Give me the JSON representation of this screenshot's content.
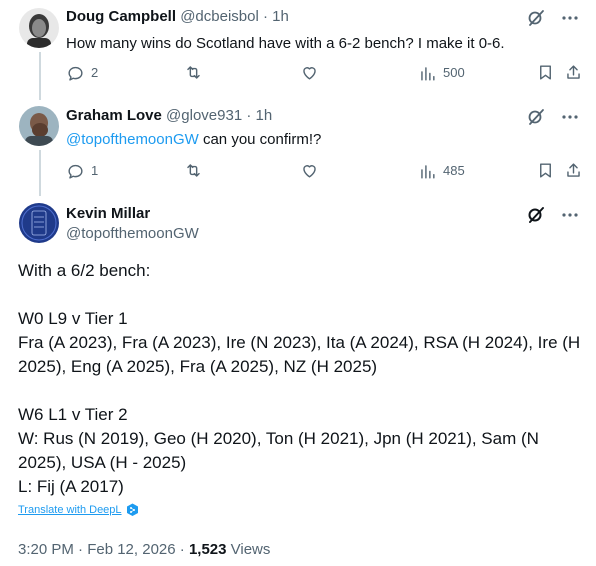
{
  "posts": [
    {
      "name": "Doug Campbell",
      "handle": "@dcbeisbol",
      "dot": "·",
      "time": "1h",
      "text": "How many wins do Scotland have with a 6-2 bench? I make it 0-6.",
      "replies": "2",
      "views": "500"
    },
    {
      "name": "Graham Love",
      "handle": "@glove931",
      "dot": "·",
      "time": "1h",
      "mention": "@topofthemoonGW",
      "text": " can you confirm!?",
      "replies": "1",
      "views": "485"
    }
  ],
  "main": {
    "name": "Kevin Millar",
    "handle": "@topofthemoonGW",
    "lines": [
      "With a 6/2 bench:",
      "",
      "W0 L9 v Tier 1",
      "Fra (A 2023), Fra (A 2023), Ire (N 2023), Ita (A 2024), RSA (H 2024), Ire (H 2025), Eng (A 2025), Fra (A 2025), NZ (H 2025)",
      "",
      "W6 L1 v Tier 2",
      "W: Rus (N 2019), Geo (H 2020), Ton (H 2021), Jpn (H 2021), Sam (N 2025), USA (H - 2025)",
      "L: Fij (A 2017)"
    ],
    "translate": "Translate with DeepL",
    "timestamp": "3:20 PM · Feb 12, 2026 · ",
    "views_count": "1,523",
    "views_label": " Views"
  },
  "icons": {
    "more": "more-dots-icon",
    "grok": "grok-slash-icon",
    "reply": "reply-bubble-icon",
    "retweet": "retweet-icon",
    "like": "heart-icon",
    "analytics": "analytics-bars-icon",
    "bookmark": "bookmark-icon",
    "share": "share-upload-icon",
    "deepl": "deepl-logo-icon"
  },
  "colors": {
    "accent": "#1d9bf0",
    "secondary_text": "#536471",
    "primary_text": "#0f1419",
    "thread_line": "#cfd9de"
  }
}
